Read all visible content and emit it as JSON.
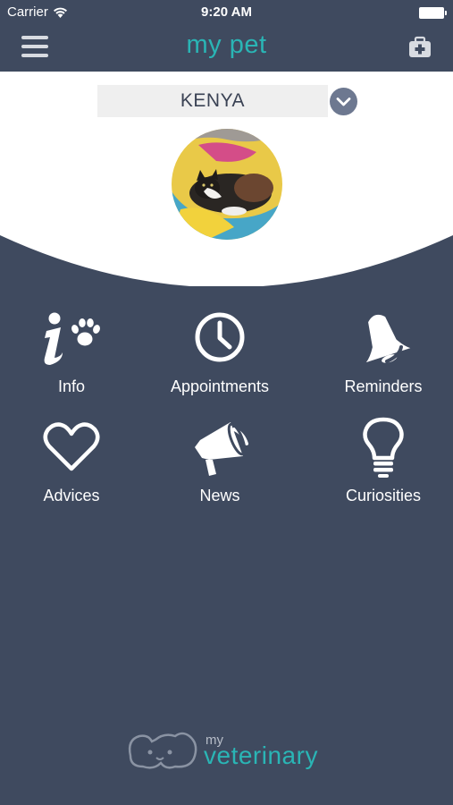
{
  "status_bar": {
    "carrier": "Carrier",
    "time": "9:20 AM"
  },
  "header": {
    "title": "my pet"
  },
  "pet": {
    "name": "KENYA"
  },
  "menu": {
    "items": [
      {
        "label": "Info",
        "icon": "info-paw-icon"
      },
      {
        "label": "Appointments",
        "icon": "clock-icon"
      },
      {
        "label": "Reminders",
        "icon": "bell-icon"
      },
      {
        "label": "Advices",
        "icon": "heart-icon"
      },
      {
        "label": "News",
        "icon": "megaphone-icon"
      },
      {
        "label": "Curiosities",
        "icon": "lightbulb-icon"
      }
    ]
  },
  "footer": {
    "brand_small": "my",
    "brand_big": "veterinary"
  },
  "colors": {
    "background": "#3f4a5f",
    "accent": "#2ab5b5",
    "header_bg": "#ffffff"
  }
}
